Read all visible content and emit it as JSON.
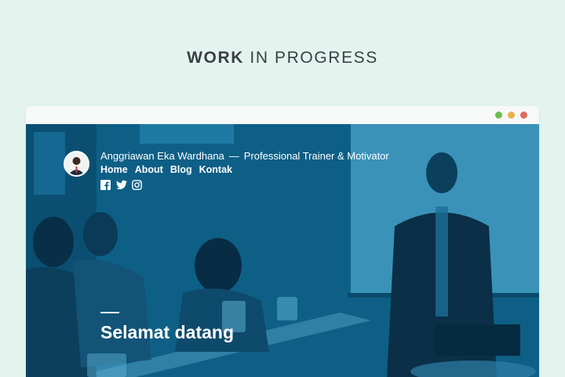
{
  "page": {
    "heading_strong": "WORK",
    "heading_rest": "IN PROGRESS"
  },
  "browser": {
    "dots": {
      "green": "#6cbf4e",
      "yellow": "#e8b14a",
      "red": "#e06a5b"
    }
  },
  "site": {
    "name": "Anggriawan Eka Wardhana",
    "separator": "—",
    "tagline": "Professional Trainer & Motivator",
    "nav": [
      "Home",
      "About",
      "Blog",
      "Kontak"
    ],
    "social_icons": [
      "facebook-icon",
      "twitter-icon",
      "instagram-icon"
    ],
    "welcome": "Selamat datang",
    "hero_tint": "#0d5f86"
  }
}
